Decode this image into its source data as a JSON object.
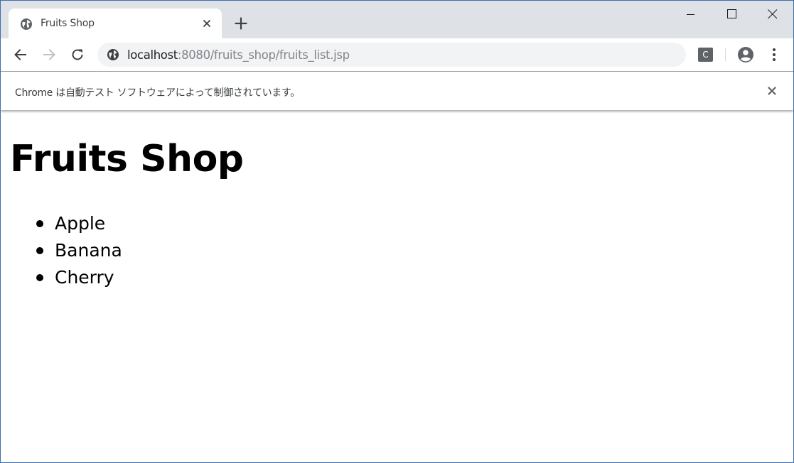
{
  "browser": {
    "tab": {
      "title": "Fruits Shop"
    },
    "address_bar": {
      "host": "localhost",
      "path": ":8080/fruits_shop/fruits_list.jsp"
    },
    "extension_label": "C",
    "infobar": {
      "message": "Chrome は自動テスト ソフトウェアによって制御されています。"
    },
    "icons": {
      "favicon": "globe-icon",
      "tab_close": "close-icon",
      "new_tab": "plus-icon",
      "back": "arrow-left-icon",
      "forward": "arrow-right-icon",
      "reload": "reload-icon",
      "site_info": "globe-icon",
      "profile": "account-circle-icon",
      "menu": "more-vert-icon"
    }
  },
  "page": {
    "title": "Fruits Shop",
    "fruits": [
      "Apple",
      "Banana",
      "Cherry"
    ]
  },
  "colors": {
    "tabstrip_bg": "#dee1e6",
    "omnibox_bg": "#f1f3f4",
    "icon_color": "#5f6368",
    "text_color": "#000000"
  }
}
